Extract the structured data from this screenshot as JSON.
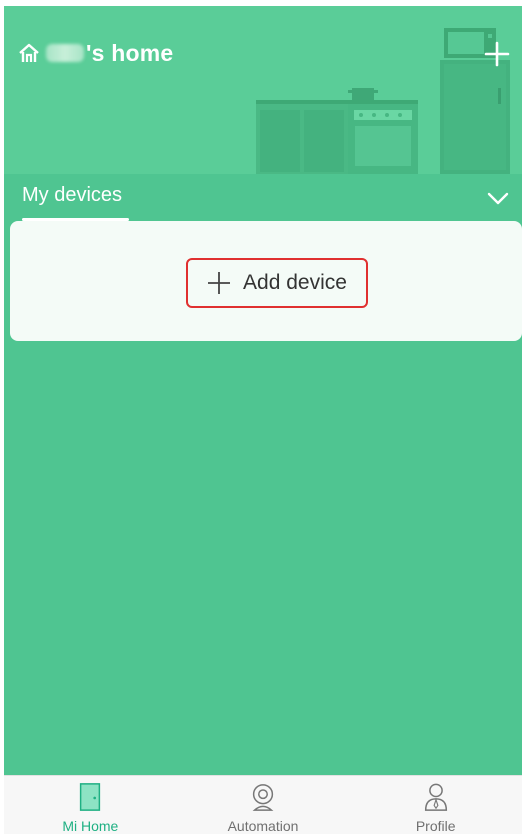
{
  "header": {
    "home_name_suffix": "'s home"
  },
  "section": {
    "tab_label": "My devices"
  },
  "device_card": {
    "add_device_label": "Add device"
  },
  "bottom_nav": {
    "items": [
      {
        "label": "Mi Home",
        "icon": "door-icon",
        "active": true
      },
      {
        "label": "Automation",
        "icon": "camera-icon",
        "active": false
      },
      {
        "label": "Profile",
        "icon": "person-icon",
        "active": false
      }
    ]
  },
  "colors": {
    "background_green": "#4fc591",
    "header_green": "#5acd98",
    "active_tab": "#1fb083",
    "highlight_border": "#e03030"
  }
}
